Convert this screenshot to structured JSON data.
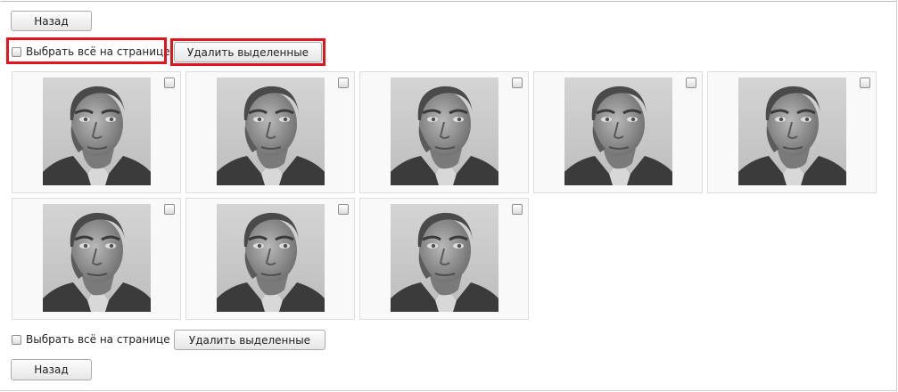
{
  "nav": {
    "back_label": "Назад"
  },
  "bulk": {
    "select_all_label": "Выбрать всё на странице",
    "delete_selected_label": "Удалить выделенные"
  },
  "photos": [
    {
      "checked": false
    },
    {
      "checked": false
    },
    {
      "checked": false
    },
    {
      "checked": false
    },
    {
      "checked": false
    },
    {
      "checked": false
    },
    {
      "checked": false
    },
    {
      "checked": false
    }
  ],
  "colors": {
    "highlight": "#e3141e",
    "tile_bg": "#f9f9f9",
    "tile_border": "#dddddd"
  },
  "icons": {
    "photo": "portrait-photo-icon",
    "checkbox": "checkbox-icon"
  }
}
